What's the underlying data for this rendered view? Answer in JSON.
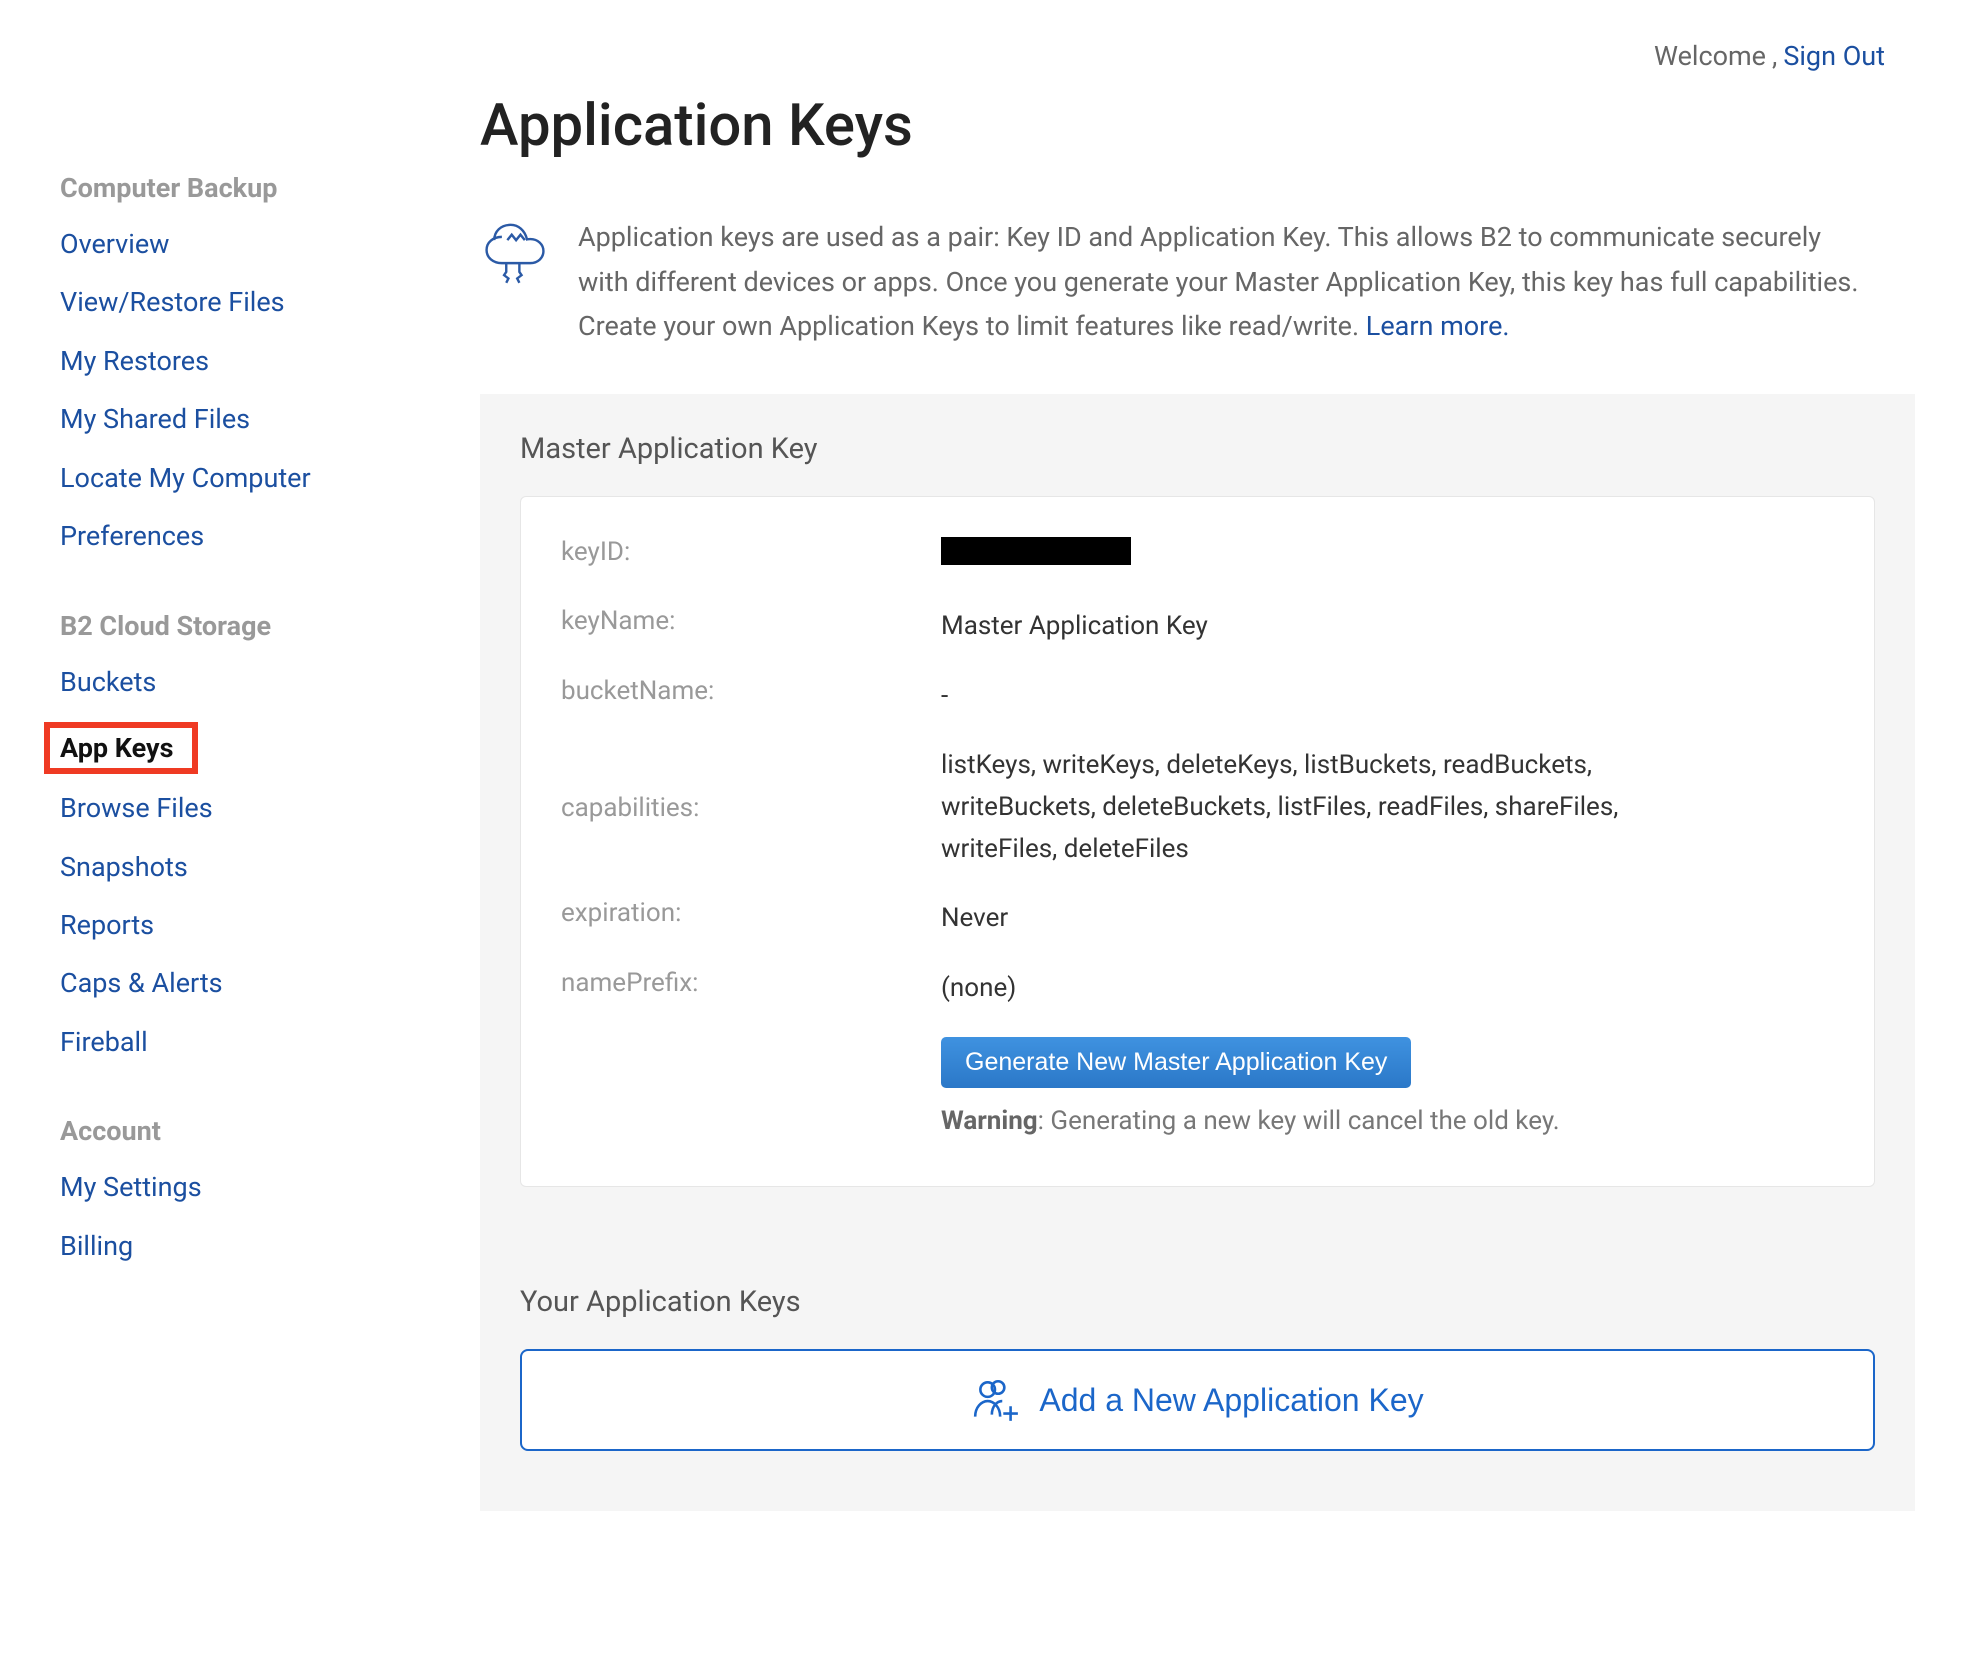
{
  "topbar": {
    "welcome_label": "Welcome",
    "separator": ", ",
    "sign_out_label": "Sign Out"
  },
  "sidebar": {
    "sections": [
      {
        "heading": "Computer Backup",
        "items": [
          {
            "label": "Overview",
            "active": false
          },
          {
            "label": "View/Restore Files",
            "active": false
          },
          {
            "label": "My Restores",
            "active": false
          },
          {
            "label": "My Shared Files",
            "active": false
          },
          {
            "label": "Locate My Computer",
            "active": false
          },
          {
            "label": "Preferences",
            "active": false
          }
        ]
      },
      {
        "heading": "B2 Cloud Storage",
        "items": [
          {
            "label": "Buckets",
            "active": false
          },
          {
            "label": "App Keys",
            "active": true
          },
          {
            "label": "Browse Files",
            "active": false
          },
          {
            "label": "Snapshots",
            "active": false
          },
          {
            "label": "Reports",
            "active": false
          },
          {
            "label": "Caps & Alerts",
            "active": false
          },
          {
            "label": "Fireball",
            "active": false
          }
        ]
      },
      {
        "heading": "Account",
        "items": [
          {
            "label": "My Settings",
            "active": false
          },
          {
            "label": "Billing",
            "active": false
          }
        ]
      }
    ]
  },
  "main": {
    "title": "Application Keys",
    "intro_text": "Application keys are used as a pair: Key ID and Application Key. This allows B2 to communicate securely with different devices or apps. Once you generate your Master Application Key, this key has full capabilities. Create your own Application Keys to limit features like read/write. ",
    "learn_more_label": "Learn more.",
    "master_panel_heading": "Master Application Key",
    "fields": {
      "keyID_label": "keyID:",
      "keyID_value_redacted": true,
      "keyName_label": "keyName:",
      "keyName_value": "Master Application Key",
      "bucketName_label": "bucketName:",
      "bucketName_value": "-",
      "capabilities_label": "capabilities:",
      "capabilities_value": "listKeys, writeKeys, deleteKeys, listBuckets, readBuckets, writeBuckets, deleteBuckets, listFiles, readFiles, shareFiles, writeFiles, deleteFiles",
      "expiration_label": "expiration:",
      "expiration_value": "Never",
      "namePrefix_label": "namePrefix:",
      "namePrefix_value": "(none)"
    },
    "generate_button_label": "Generate New Master Application Key",
    "warning_prefix": "Warning",
    "warning_text": ": Generating a new key will cancel the old key.",
    "your_keys_heading": "Your Application Keys",
    "add_key_button_label": "Add a New Application Key"
  }
}
